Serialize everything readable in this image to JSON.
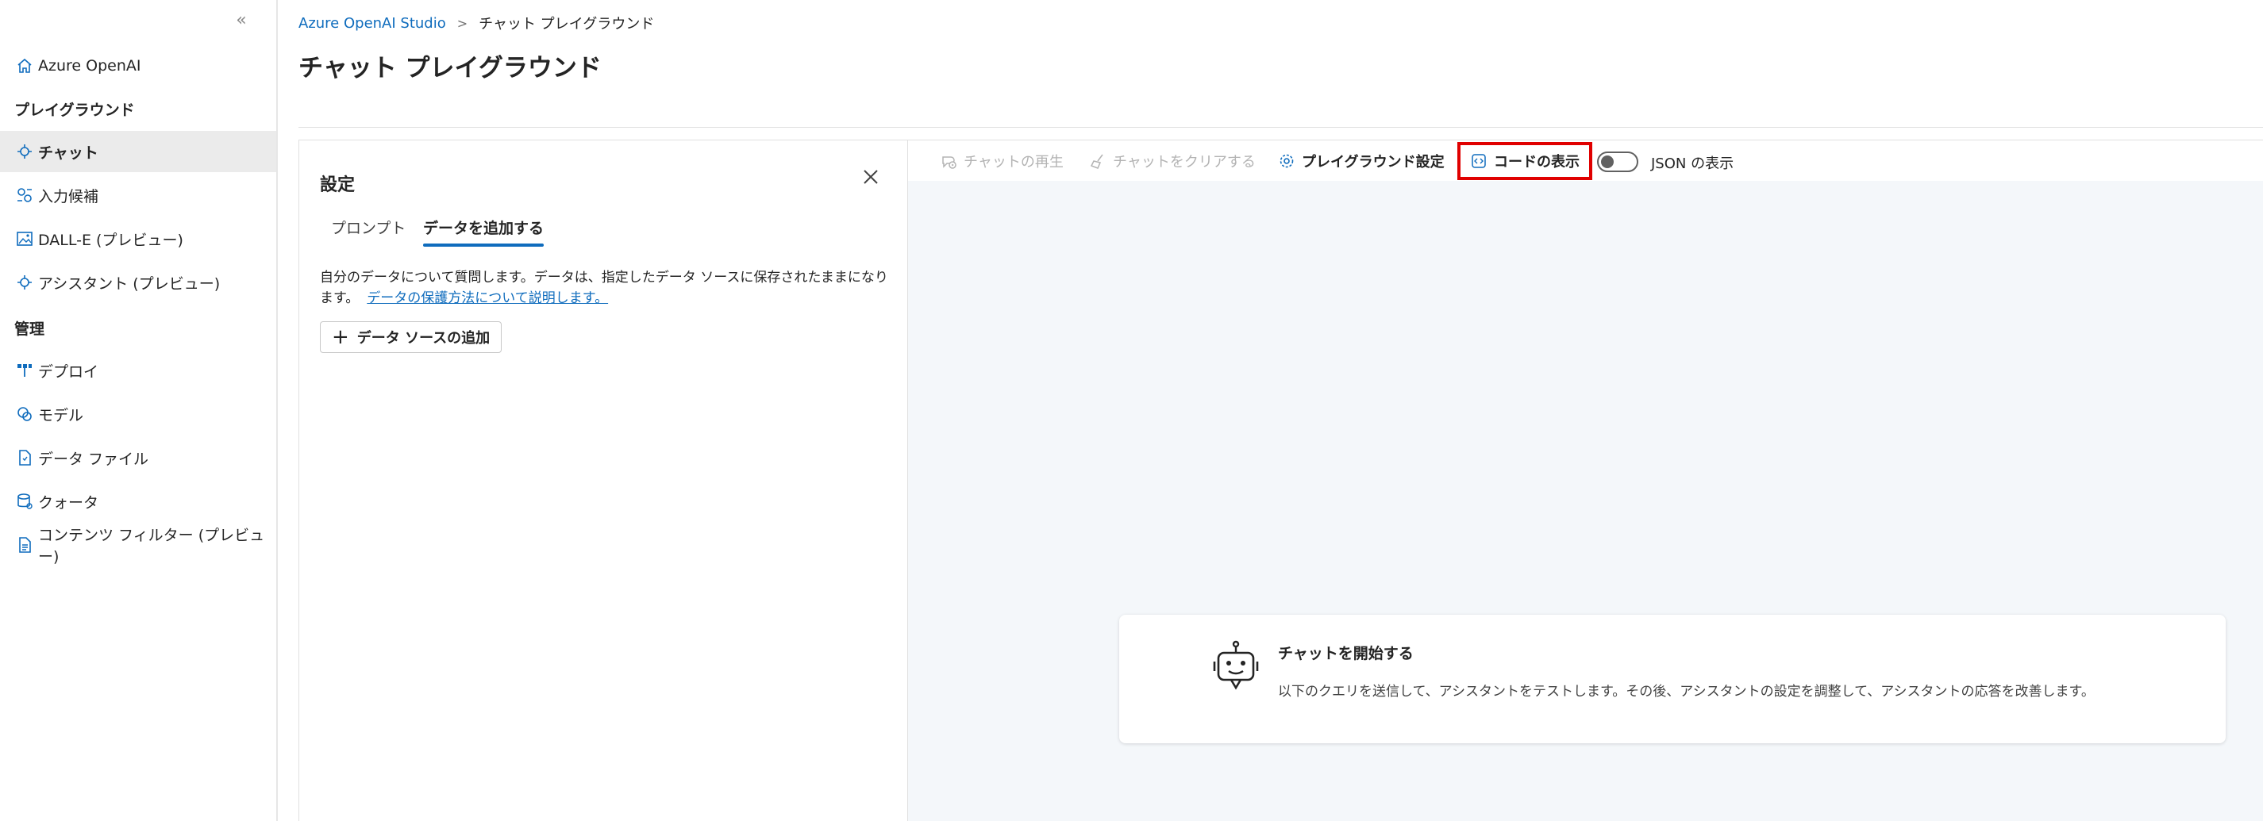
{
  "sidebar": {
    "collapse_glyph": "«",
    "items": [
      {
        "label": "Azure OpenAI",
        "icon": "home-icon"
      },
      {
        "label": "チャット",
        "icon": "chat-icon",
        "active": true
      },
      {
        "label": "入力候補",
        "icon": "completions-icon"
      },
      {
        "label": "DALL-E (プレビュー)",
        "icon": "image-icon"
      },
      {
        "label": "アシスタント (プレビュー)",
        "icon": "assistant-icon"
      },
      {
        "label": "デプロイ",
        "icon": "deploy-icon"
      },
      {
        "label": "モデル",
        "icon": "model-icon"
      },
      {
        "label": "データ ファイル",
        "icon": "data-file-icon"
      },
      {
        "label": "クォータ",
        "icon": "quota-icon"
      },
      {
        "label": "コンテンツ フィルター (プレビュー)",
        "icon": "content-filter-icon"
      }
    ],
    "sections": {
      "playground": "プレイグラウンド",
      "management": "管理"
    }
  },
  "header": {
    "breadcrumb": {
      "root": "Azure OpenAI Studio",
      "current": "チャット プレイグラウンド"
    },
    "title": "チャット プレイグラウンド"
  },
  "settings": {
    "title": "設定",
    "tabs": [
      {
        "label": "プロンプト",
        "active": false
      },
      {
        "label": "データを追加する",
        "active": true
      }
    ],
    "description": "自分のデータについて質問します。データは、指定したデータ ソースに保存されたままになります。",
    "learn_link": "データの保護方法について説明します。",
    "add_source_label": "データ ソースの追加"
  },
  "toolbar": {
    "replay_label": "チャットの再生",
    "clear_label": "チャットをクリアする",
    "settings_label": "プレイグラウンド設定",
    "code_label": "コードの表示",
    "json_label": "JSON の表示",
    "json_toggle_on": false,
    "highlight_color": "#e00000"
  },
  "welcome": {
    "title": "チャットを開始する",
    "text": "以下のクエリを送信して、アシスタントをテストします。その後、アシスタントの設定を調整して、アシスタントの応答を改善します。"
  },
  "colors": {
    "accent": "#0f6cbd",
    "chat_background": "#f4f7fa",
    "disabled_text": "#b3b3b3"
  }
}
